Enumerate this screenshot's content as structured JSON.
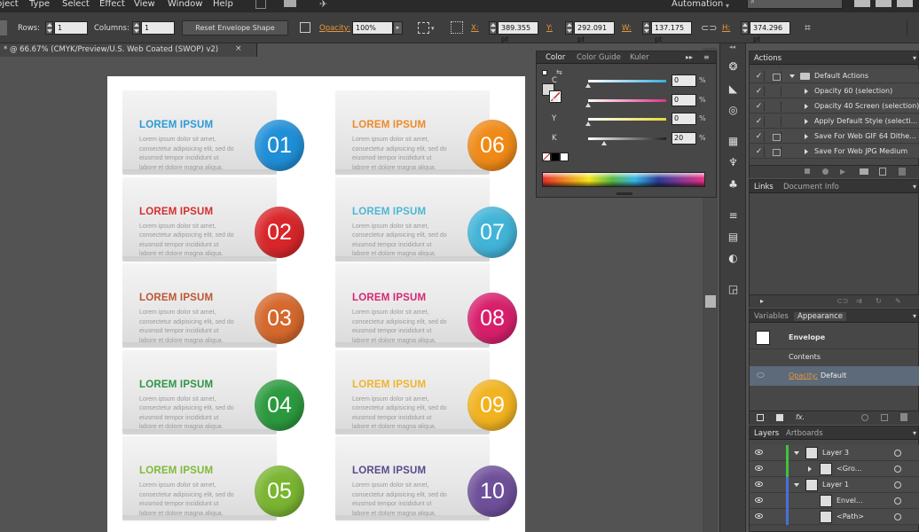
{
  "menubar": {
    "items": [
      "bject",
      "Type",
      "Select",
      "Effect",
      "View",
      "Window",
      "Help"
    ],
    "workspace": "Automation"
  },
  "controlbar": {
    "rows_label": "Rows:",
    "rows_value": "1",
    "columns_label": "Columns:",
    "columns_value": "1",
    "reset_button": "Reset Envelope Shape",
    "opacity_label": "Opacity:",
    "opacity_value": "100%",
    "x_label": "X:",
    "x_value": "389.355 pt",
    "y_label": "Y:",
    "y_value": "292.091 pt",
    "w_label": "W:",
    "w_value": "137.175 pt",
    "h_label": "H:",
    "h_value": "374.296 pt"
  },
  "document_tab": {
    "title": "* @ 66.67% (CMYK/Preview/U.S. Web Coated (SWOP) v2)",
    "close": "×"
  },
  "infographic": {
    "cards": [
      {
        "number": "01",
        "title": "LOREM IPSUM",
        "color": "#1f8fd8",
        "title_color": "#2b9ad6"
      },
      {
        "number": "02",
        "title": "LOREM IPSUM",
        "color": "#d8262a",
        "title_color": "#d32f2f"
      },
      {
        "number": "03",
        "title": "LOREM IPSUM",
        "color": "#d5682c",
        "title_color": "#bb5733"
      },
      {
        "number": "04",
        "title": "LOREM IPSUM",
        "color": "#2b9a3e",
        "title_color": "#2e9446"
      },
      {
        "number": "05",
        "title": "LOREM IPSUM",
        "color": "#7ab531",
        "title_color": "#82b83a"
      },
      {
        "number": "06",
        "title": "LOREM IPSUM",
        "color": "#f08a17",
        "title_color": "#ee8a27"
      },
      {
        "number": "07",
        "title": "LOREM IPSUM",
        "color": "#41b4d8",
        "title_color": "#4cb7d6"
      },
      {
        "number": "08",
        "title": "LOREM IPSUM",
        "color": "#d81f6c",
        "title_color": "#d42775"
      },
      {
        "number": "09",
        "title": "LOREM IPSUM",
        "color": "#f2b320",
        "title_color": "#eeb42c"
      },
      {
        "number": "10",
        "title": "LOREM IPSUM",
        "color": "#6e4f9a",
        "title_color": "#5a4a8c"
      }
    ],
    "body_lines": [
      "Lorem ipsum dolor sit amet,",
      "consectetur adipisicing elit, sed do",
      "eiusmod tempor incididunt ut",
      "labore et dolore magna aliqua."
    ]
  },
  "color_panel": {
    "tabs": [
      "Color",
      "Color Guide",
      "Kuler"
    ],
    "sliders": [
      {
        "label": "C",
        "value": "0",
        "pct": "%",
        "color": "#37aee2",
        "level": 0
      },
      {
        "label": "M",
        "value": "0",
        "pct": "%",
        "color": "#e0318a",
        "level": 0
      },
      {
        "label": "Y",
        "value": "0",
        "pct": "%",
        "color": "#e8d839",
        "level": 0
      },
      {
        "label": "K",
        "value": "20",
        "pct": "%",
        "color": "#222222",
        "level": 0.2
      }
    ]
  },
  "actions_panel": {
    "title": "Actions",
    "rows": [
      {
        "label": "Default Actions",
        "kind": "folder"
      },
      {
        "label": "Opacity 60 (selection)",
        "kind": "action"
      },
      {
        "label": "Opacity 40 Screen (selection)",
        "kind": "action"
      },
      {
        "label": "Apply Default Style (selecti...",
        "kind": "action"
      },
      {
        "label": "Save For Web GIF 64 Dithe...",
        "kind": "action"
      },
      {
        "label": "Save For Web JPG Medium",
        "kind": "action"
      }
    ]
  },
  "links_panel": {
    "tabs": [
      "Links",
      "Document Info"
    ]
  },
  "appearance_panel": {
    "tabs": [
      "Variables",
      "Appearance"
    ],
    "object": "Envelope",
    "contents": "Contents",
    "opacity_label": "Opacity:",
    "opacity_value": "Default",
    "fx": "fx."
  },
  "layers_panel": {
    "tabs": [
      "Layers",
      "Artboards"
    ],
    "rows": [
      {
        "label": "Layer 3",
        "bar_color": "#3ec43e",
        "indent": 0
      },
      {
        "label": "<Gro...",
        "bar_color": "#3ec43e",
        "indent": 1
      },
      {
        "label": "Layer 1",
        "bar_color": "#4a6fd8",
        "indent": 0
      },
      {
        "label": "Envel...",
        "bar_color": "#4a6fd8",
        "indent": 1
      },
      {
        "label": "<Path>",
        "bar_color": "#4a6fd8",
        "indent": 1
      }
    ]
  }
}
